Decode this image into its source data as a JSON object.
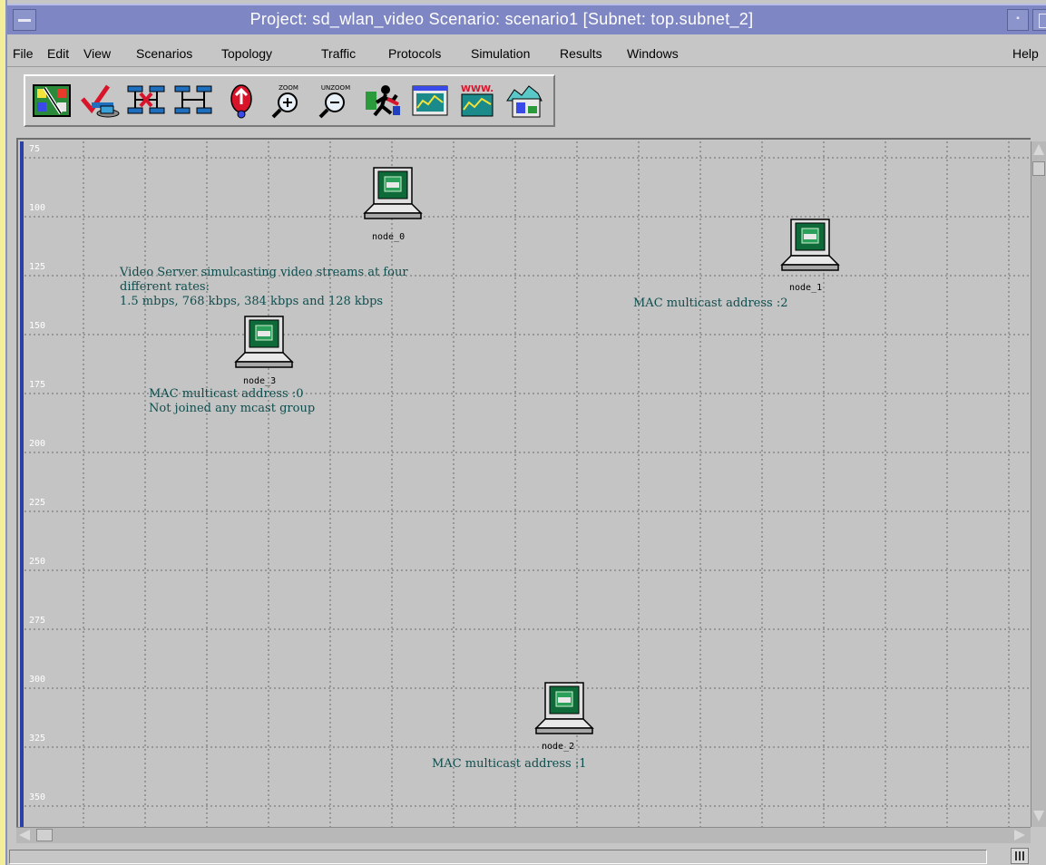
{
  "window": {
    "title": "Project: sd_wlan_video Scenario: scenario1  [Subnet: top.subnet_2]"
  },
  "menu": {
    "items": [
      "File",
      "Edit",
      "View",
      "Scenarios",
      "Topology",
      "Traffic",
      "Protocols",
      "Simulation",
      "Results",
      "Windows"
    ],
    "help": "Help"
  },
  "toolbar": {
    "buttons": [
      {
        "icon": "object-palette-icon"
      },
      {
        "icon": "check-links-icon"
      },
      {
        "icon": "fail-link-icon"
      },
      {
        "icon": "recover-link-icon"
      },
      {
        "icon": "return-to-parent-icon"
      },
      {
        "icon": "zoom-icon",
        "caption": "ZOOM"
      },
      {
        "icon": "unzoom-icon",
        "caption": "UNZOOM"
      },
      {
        "icon": "run-simulation-icon"
      },
      {
        "icon": "view-results-icon"
      },
      {
        "icon": "web-report-icon",
        "caption": "WWW."
      },
      {
        "icon": "animation-icon"
      }
    ]
  },
  "canvas": {
    "rulers": [
      "75",
      "100",
      "125",
      "150",
      "175",
      "200",
      "225",
      "250",
      "275",
      "300",
      "325",
      "350"
    ],
    "nodes": [
      {
        "name": "node_0"
      },
      {
        "name": "node_1"
      },
      {
        "name": "node_2"
      },
      {
        "name": "node_3"
      }
    ],
    "annotations": {
      "video_server": "Video Server simulcasting video streams at four\ndifferent rates:\n1.5 mbps, 768 kbps, 384 kbps and 128 kbps",
      "node_1_mac": "MAC multicast address :2",
      "node_3_mac": "MAC multicast address :0\nNot joined any mcast group",
      "node_2_mac": "MAC multicast address :1"
    }
  },
  "status": {
    "text": ""
  },
  "colors": {
    "titlebar": "#7e86c4",
    "canvas_bg": "#c4c4c4",
    "annotation_text": "#0f4d4d",
    "ruler_bar": "#2b3fa8"
  }
}
